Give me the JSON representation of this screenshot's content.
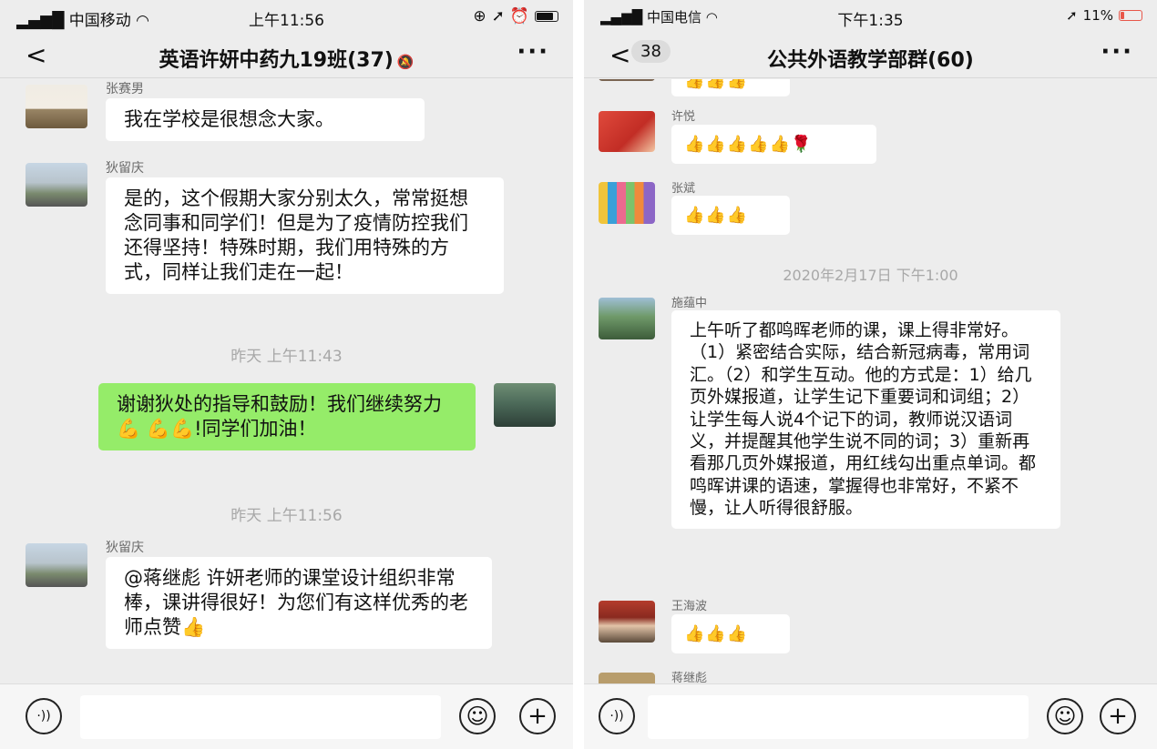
{
  "left": {
    "status": {
      "carrier": "中国移动",
      "time": "上午11:56"
    },
    "nav": {
      "back": "<",
      "title": "英语许妍中药九19班(37)",
      "more": "···"
    },
    "messages": [
      {
        "sender": "张赛男",
        "text": "我在学校是很想念大家。"
      },
      {
        "sender": "狄留庆",
        "text": "是的，这个假期大家分别太久，常常挺想念同事和同学们！但是为了疫情防控我们还得坚持！特殊时期，我们用特殊的方式，同样让我们走在一起！"
      },
      {
        "timestamp": "昨天 上午11:43"
      },
      {
        "text": "谢谢狄处的指导和鼓励！我们继续努力💪 💪💪!同学们加油！"
      },
      {
        "timestamp": "昨天 上午11:56"
      },
      {
        "sender": "狄留庆",
        "text": "@蒋继彪 许妍老师的课堂设计组织非常棒，课讲得很好！为您们有这样优秀的老师点赞👍"
      }
    ],
    "input": {
      "voice": "·))",
      "emoji": "☺",
      "plus": "+"
    }
  },
  "right": {
    "status": {
      "carrier": "中国电信",
      "time": "下午1:35",
      "battery": "11%"
    },
    "nav": {
      "back": "<",
      "unread": "38",
      "title": "公共外语教学部群(60)",
      "more": "···"
    },
    "messages": [
      {
        "text": "👍👍👍"
      },
      {
        "sender": "许悦",
        "text": "👍👍👍👍👍🌹"
      },
      {
        "sender": "张斌",
        "text": "👍👍👍"
      },
      {
        "timestamp": "2020年2月17日 下午1:00"
      },
      {
        "sender": "施蕴中",
        "text": "上午听了都鸣晖老师的课，课上得非常好。（1）紧密结合实际，结合新冠病毒，常用词汇。（2）和学生互动。他的方式是：1）给几页外媒报道，让学生记下重要词和词组；2）让学生每人说4个记下的词，教师说汉语词义，并提醒其他学生说不同的词；3）重新再看那几页外媒报道，用红线勾出重点单词。都鸣晖讲课的语速，掌握得也非常好，不紧不慢，让人听得很舒服。"
      },
      {
        "sender": "王海波",
        "text": "👍👍👍"
      },
      {
        "sender": "蒋继彪"
      }
    ],
    "input": {
      "voice": "·))",
      "emoji": "☺",
      "plus": "+"
    }
  },
  "colors": {
    "chat_bg": "#ededed",
    "own_bubble": "#95ec69",
    "other_bubble": "#ffffff",
    "timestamp": "#a8a8a8",
    "battery_low": "#e8574a"
  }
}
